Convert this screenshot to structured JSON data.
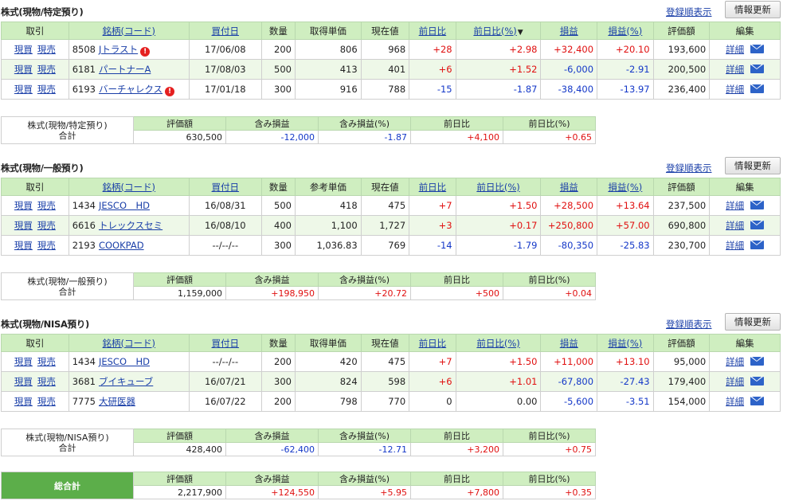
{
  "ui": {
    "sort_link": "登録順表示",
    "refresh_button": "情報更新",
    "detail_label": "詳細",
    "buy_label": "現買",
    "sell_label": "現売",
    "sort_arrow": "▼",
    "tot_headers": [
      "評価額",
      "含み損益",
      "含み損益(%)",
      "前日比",
      "前日比(%)"
    ]
  },
  "sections": [
    {
      "title": "株式(現物/特定預り)",
      "headers": [
        "取引",
        "銘柄(コード)",
        "買付日",
        "数量",
        "取得単価",
        "現在値",
        "前日比",
        "前日比(%)",
        "損益",
        "損益(%)",
        "評価額",
        "編集"
      ],
      "rows": [
        {
          "code": "8508",
          "name": "Jトラスト",
          "warn": true,
          "date": "17/06/08",
          "qty": "200",
          "cost": "806",
          "price": "968",
          "chg": "+28",
          "chg_pct": "+2.98",
          "pl": "+32,400",
          "pl_pct": "+20.10",
          "value": "193,600"
        },
        {
          "code": "6181",
          "name": "パートナーA",
          "warn": false,
          "date": "17/08/03",
          "qty": "500",
          "cost": "413",
          "price": "401",
          "chg": "+6",
          "chg_pct": "+1.52",
          "pl": "-6,000",
          "pl_pct": "-2.91",
          "value": "200,500"
        },
        {
          "code": "6193",
          "name": "バーチャレクス",
          "warn": true,
          "date": "17/01/18",
          "qty": "300",
          "cost": "916",
          "price": "788",
          "chg": "-15",
          "chg_pct": "-1.87",
          "pl": "-38,400",
          "pl_pct": "-13.97",
          "value": "236,400"
        }
      ],
      "total": {
        "label1": "株式(現物/特定預り)",
        "label2": "合計",
        "value": "630,500",
        "pl": "-12,000",
        "pl_pct": "-1.87",
        "chg": "+4,100",
        "chg_pct": "+0.65"
      }
    },
    {
      "title": "株式(現物/一般預り)",
      "headers": [
        "取引",
        "銘柄(コード)",
        "買付日",
        "数量",
        "参考単価",
        "現在値",
        "前日比",
        "前日比(%)",
        "損益",
        "損益(%)",
        "評価額",
        "編集"
      ],
      "rows": [
        {
          "code": "1434",
          "name": "JESCO　HD",
          "warn": false,
          "date": "16/08/31",
          "qty": "500",
          "cost": "418",
          "price": "475",
          "chg": "+7",
          "chg_pct": "+1.50",
          "pl": "+28,500",
          "pl_pct": "+13.64",
          "value": "237,500"
        },
        {
          "code": "6616",
          "name": "トレックスセミ",
          "warn": false,
          "date": "16/08/10",
          "qty": "400",
          "cost": "1,100",
          "price": "1,727",
          "chg": "+3",
          "chg_pct": "+0.17",
          "pl": "+250,800",
          "pl_pct": "+57.00",
          "value": "690,800"
        },
        {
          "code": "2193",
          "name": "COOKPAD",
          "warn": false,
          "date": "--/--/--",
          "qty": "300",
          "cost": "1,036.83",
          "price": "769",
          "chg": "-14",
          "chg_pct": "-1.79",
          "pl": "-80,350",
          "pl_pct": "-25.83",
          "value": "230,700"
        }
      ],
      "total": {
        "label1": "株式(現物/一般預り)",
        "label2": "合計",
        "value": "1,159,000",
        "pl": "+198,950",
        "pl_pct": "+20.72",
        "chg": "+500",
        "chg_pct": "+0.04"
      }
    },
    {
      "title": "株式(現物/NISA預り)",
      "headers": [
        "取引",
        "銘柄(コード)",
        "買付日",
        "数量",
        "取得単価",
        "現在値",
        "前日比",
        "前日比(%)",
        "損益",
        "損益(%)",
        "評価額",
        "編集"
      ],
      "rows": [
        {
          "code": "1434",
          "name": "JESCO　HD",
          "warn": false,
          "date": "--/--/--",
          "qty": "200",
          "cost": "420",
          "price": "475",
          "chg": "+7",
          "chg_pct": "+1.50",
          "pl": "+11,000",
          "pl_pct": "+13.10",
          "value": "95,000"
        },
        {
          "code": "3681",
          "name": "ブイキューブ",
          "warn": false,
          "date": "16/07/21",
          "qty": "300",
          "cost": "824",
          "price": "598",
          "chg": "+6",
          "chg_pct": "+1.01",
          "pl": "-67,800",
          "pl_pct": "-27.43",
          "value": "179,400"
        },
        {
          "code": "7775",
          "name": "大研医器",
          "warn": false,
          "date": "16/07/22",
          "qty": "200",
          "cost": "798",
          "price": "770",
          "chg": "0",
          "chg_pct": "0.00",
          "pl": "-5,600",
          "pl_pct": "-3.51",
          "value": "154,000"
        }
      ],
      "total": {
        "label1": "株式(現物/NISA預り)",
        "label2": "合計",
        "value": "428,400",
        "pl": "-62,400",
        "pl_pct": "-12.71",
        "chg": "+3,200",
        "chg_pct": "+0.75"
      }
    }
  ],
  "grand_total": {
    "label": "総合計",
    "value": "2,217,900",
    "pl": "+124,550",
    "pl_pct": "+5.95",
    "chg": "+7,800",
    "chg_pct": "+0.35"
  }
}
